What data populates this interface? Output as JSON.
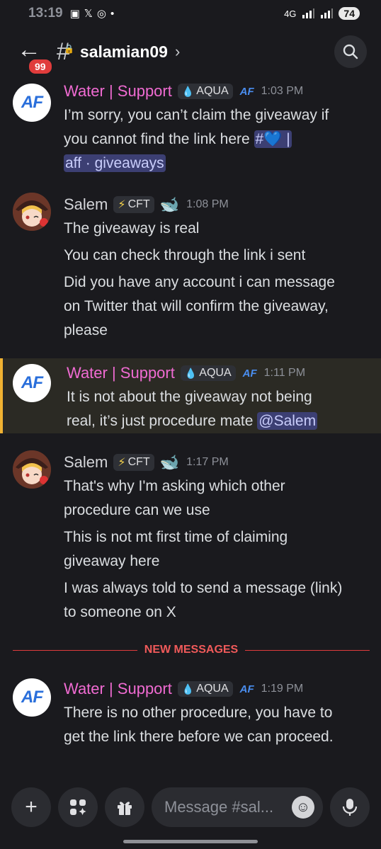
{
  "status_bar": {
    "time": "13:19",
    "network": "4G",
    "battery": "74"
  },
  "header": {
    "unread_badge": "99",
    "channel_name": "salamian09"
  },
  "messages": [
    {
      "author": "Water | Support",
      "tag": "AQUA",
      "badge": "AF",
      "time": "1:03 PM",
      "lines": [
        "I’m sorry, you can’t claim the giveaway if",
        "you cannot find the link here"
      ],
      "mention_line1": "#💙 |",
      "mention_line2": "aff · giveaways"
    },
    {
      "author": "Salem",
      "tag": "CFT",
      "time": "1:08 PM",
      "lines": [
        "The giveaway is real",
        "You can check through the link i sent",
        "Did you have any account i can message",
        "on Twitter that will confirm the giveaway,",
        "please"
      ]
    },
    {
      "author": "Water | Support",
      "tag": "AQUA",
      "badge": "AF",
      "time": "1:11 PM",
      "lines": [
        "It is not about the giveaway not being",
        "real, it’s just procedure mate"
      ],
      "mention": "@Salem"
    },
    {
      "author": "Salem",
      "tag": "CFT",
      "time": "1:17 PM",
      "lines": [
        "That's why I'm asking which other",
        "procedure can we use",
        "This is not mt first time of claiming",
        "giveaway here",
        "I was always told to send a message (link)",
        "to someone on X"
      ]
    },
    {
      "author": "Water | Support",
      "tag": "AQUA",
      "badge": "AF",
      "time": "1:19 PM",
      "lines": [
        "There is no other procedure, you have to",
        "get the link there before we can proceed."
      ]
    }
  ],
  "divider_label": "NEW MESSAGES",
  "composer": {
    "placeholder": "Message #sal..."
  },
  "colors": {
    "background": "#1a1a1e",
    "support_name": "#f06bd2",
    "highlight_border": "#f0b232",
    "new_messages": "#e03c3c"
  }
}
